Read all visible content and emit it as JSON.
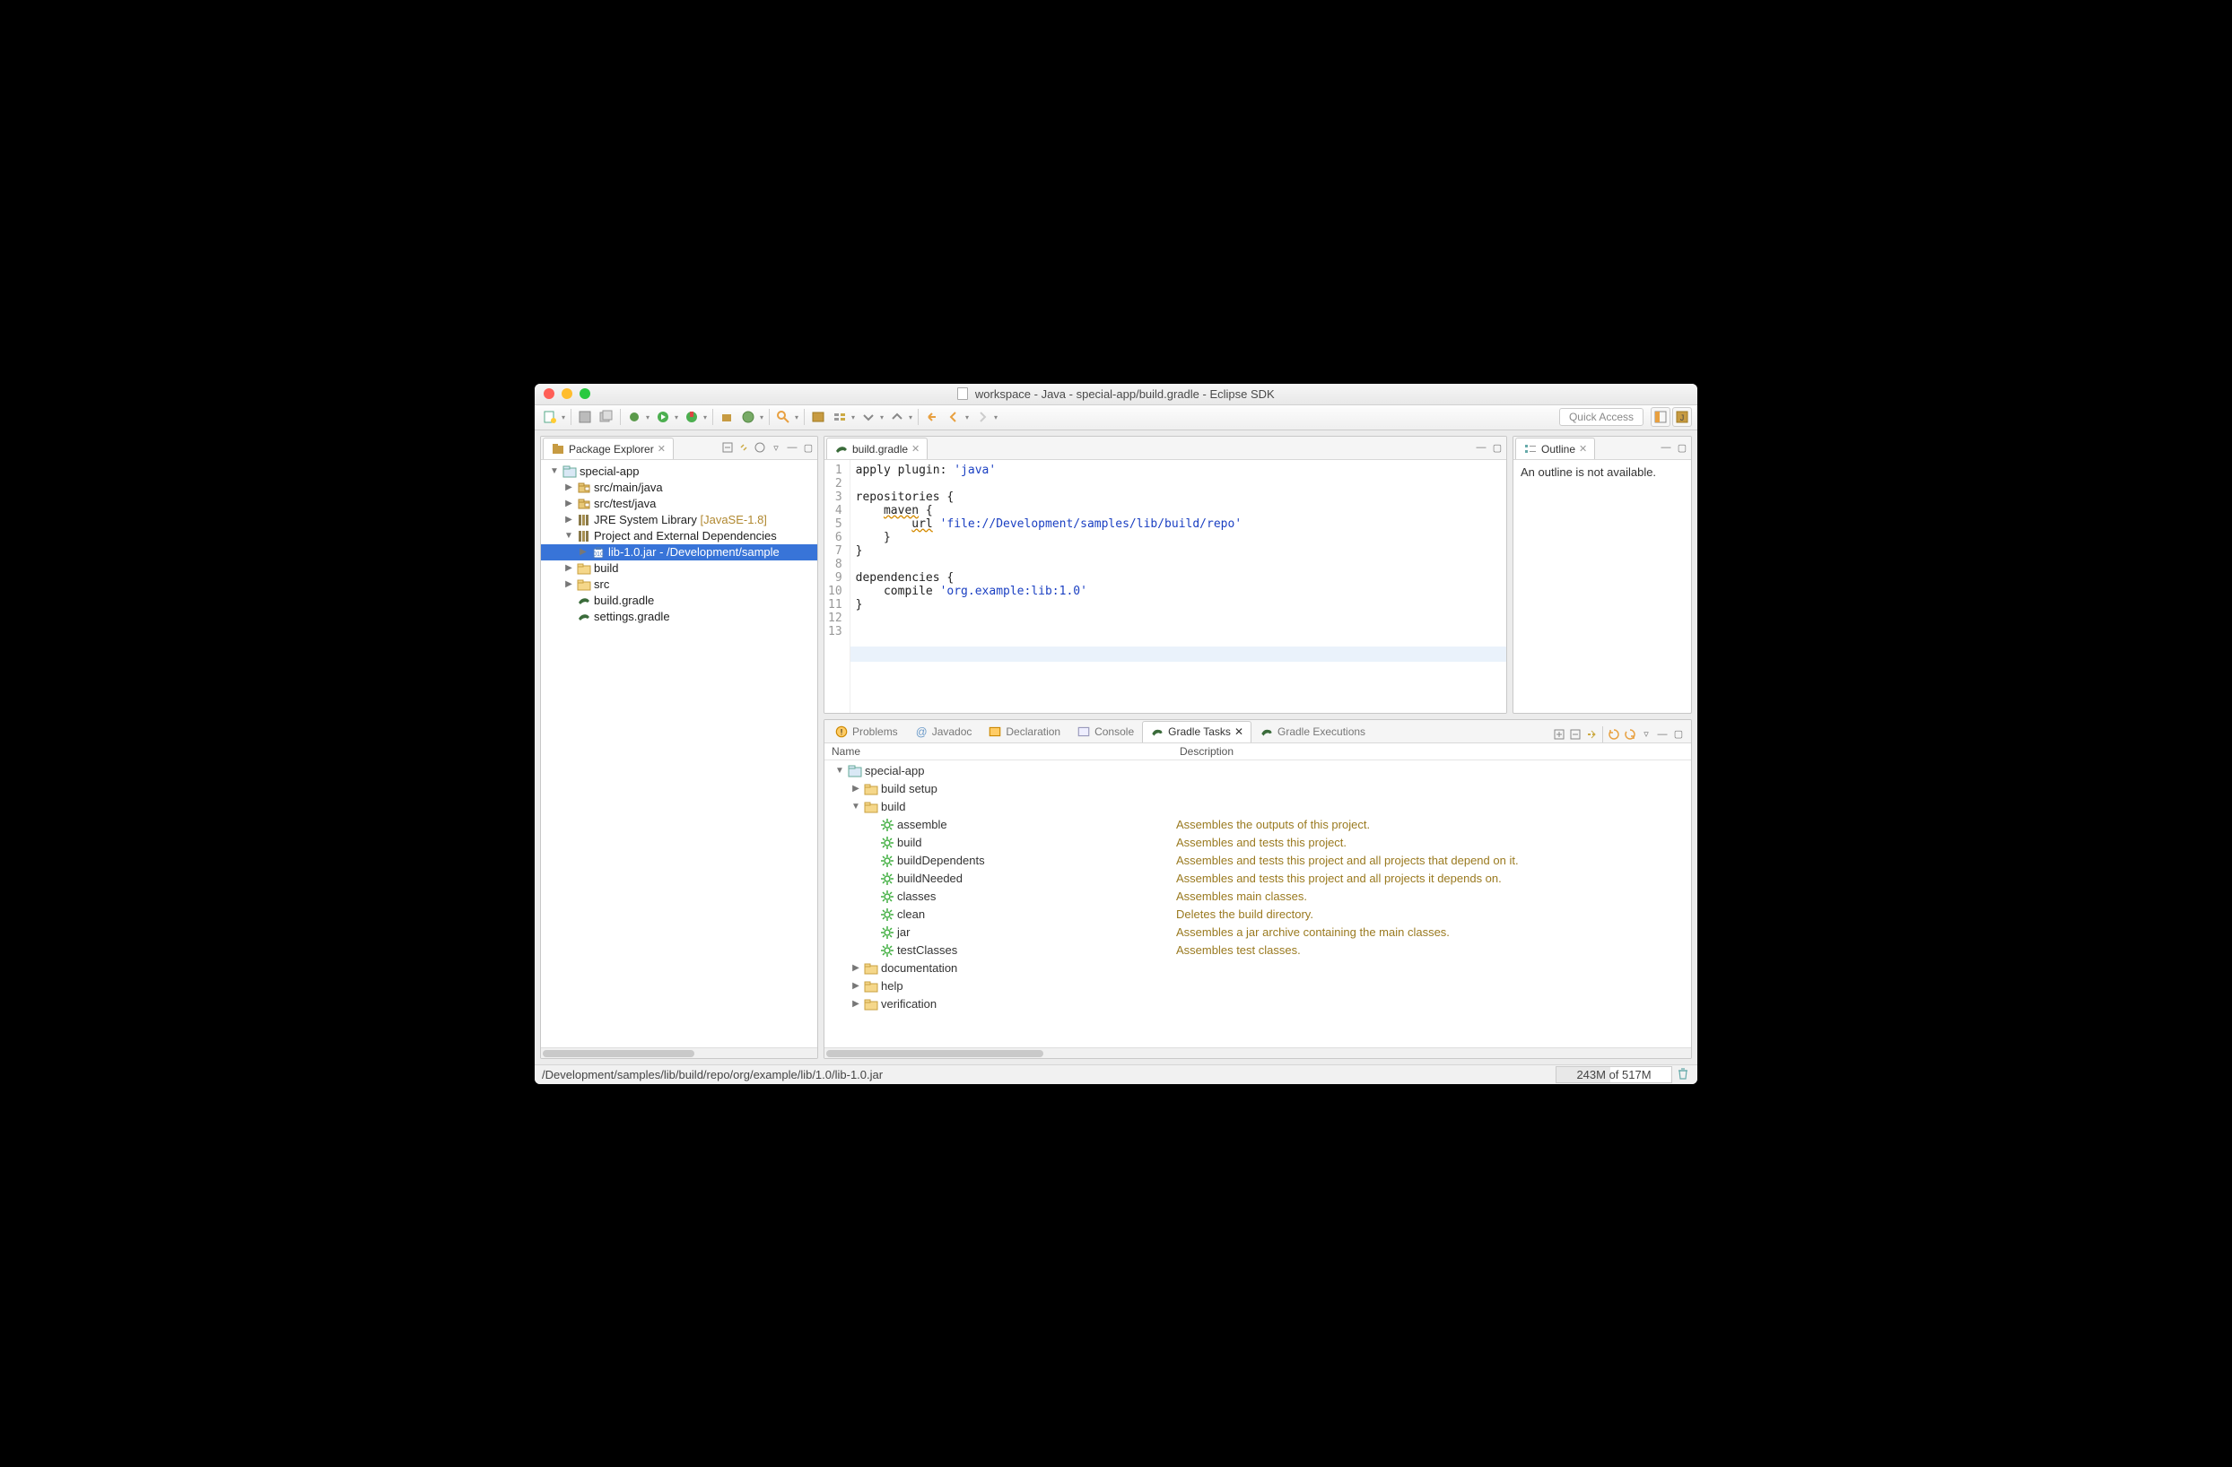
{
  "window": {
    "title": "workspace - Java - special-app/build.gradle - Eclipse SDK"
  },
  "quickAccess": "Quick Access",
  "explorer": {
    "title": "Package Explorer",
    "tree": [
      {
        "l": 0,
        "d": "▼",
        "ic": "proj",
        "t": "special-app"
      },
      {
        "l": 1,
        "d": "▶",
        "ic": "pkg",
        "t": "src/main/java"
      },
      {
        "l": 1,
        "d": "▶",
        "ic": "pkg",
        "t": "src/test/java"
      },
      {
        "l": 1,
        "d": "▶",
        "ic": "lib",
        "t": "JRE System Library",
        "hint": "[JavaSE-1.8]"
      },
      {
        "l": 1,
        "d": "▼",
        "ic": "lib",
        "t": "Project and External Dependencies"
      },
      {
        "l": 2,
        "d": "▶",
        "ic": "jar",
        "t": "lib-1.0.jar - /Development/sample",
        "sel": true
      },
      {
        "l": 1,
        "d": "▶",
        "ic": "folder",
        "t": "build"
      },
      {
        "l": 1,
        "d": "▶",
        "ic": "folder",
        "t": "src"
      },
      {
        "l": 1,
        "d": "",
        "ic": "gradle",
        "t": "build.gradle"
      },
      {
        "l": 1,
        "d": "",
        "ic": "gradle",
        "t": "settings.gradle"
      }
    ]
  },
  "editor": {
    "tab": "build.gradle",
    "lines": [
      "apply plugin: 'java'",
      "",
      "repositories {",
      "    maven {",
      "        url 'file://Development/samples/lib/build/repo'",
      "    }",
      "}",
      "",
      "dependencies {",
      "    compile 'org.example:lib:1.0'",
      "}",
      "",
      ""
    ],
    "highlightLine": 13
  },
  "outline": {
    "title": "Outline",
    "message": "An outline is not available."
  },
  "bottom": {
    "tabs": [
      "Problems",
      "Javadoc",
      "Declaration",
      "Console",
      "Gradle Tasks",
      "Gradle Executions"
    ],
    "active": 4,
    "cols": {
      "name": "Name",
      "desc": "Description"
    },
    "tasks": [
      {
        "l": 0,
        "d": "▼",
        "ic": "proj",
        "t": "special-app"
      },
      {
        "l": 1,
        "d": "▶",
        "ic": "fld",
        "t": "build setup"
      },
      {
        "l": 1,
        "d": "▼",
        "ic": "fld",
        "t": "build"
      },
      {
        "l": 2,
        "d": "",
        "ic": "gear",
        "t": "assemble",
        "desc": "Assembles the outputs of this project."
      },
      {
        "l": 2,
        "d": "",
        "ic": "gear",
        "t": "build",
        "desc": "Assembles and tests this project."
      },
      {
        "l": 2,
        "d": "",
        "ic": "gear",
        "t": "buildDependents",
        "desc": "Assembles and tests this project and all projects that depend on it."
      },
      {
        "l": 2,
        "d": "",
        "ic": "gear",
        "t": "buildNeeded",
        "desc": "Assembles and tests this project and all projects it depends on."
      },
      {
        "l": 2,
        "d": "",
        "ic": "gear",
        "t": "classes",
        "desc": "Assembles main classes."
      },
      {
        "l": 2,
        "d": "",
        "ic": "gear",
        "t": "clean",
        "desc": "Deletes the build directory."
      },
      {
        "l": 2,
        "d": "",
        "ic": "gear",
        "t": "jar",
        "desc": "Assembles a jar archive containing the main classes."
      },
      {
        "l": 2,
        "d": "",
        "ic": "gear",
        "t": "testClasses",
        "desc": "Assembles test classes."
      },
      {
        "l": 1,
        "d": "▶",
        "ic": "fld",
        "t": "documentation"
      },
      {
        "l": 1,
        "d": "▶",
        "ic": "fld",
        "t": "help"
      },
      {
        "l": 1,
        "d": "▶",
        "ic": "fld",
        "t": "verification"
      }
    ]
  },
  "status": {
    "path": "/Development/samples/lib/build/repo/org/example/lib/1.0/lib-1.0.jar",
    "heap": "243M of 517M"
  }
}
